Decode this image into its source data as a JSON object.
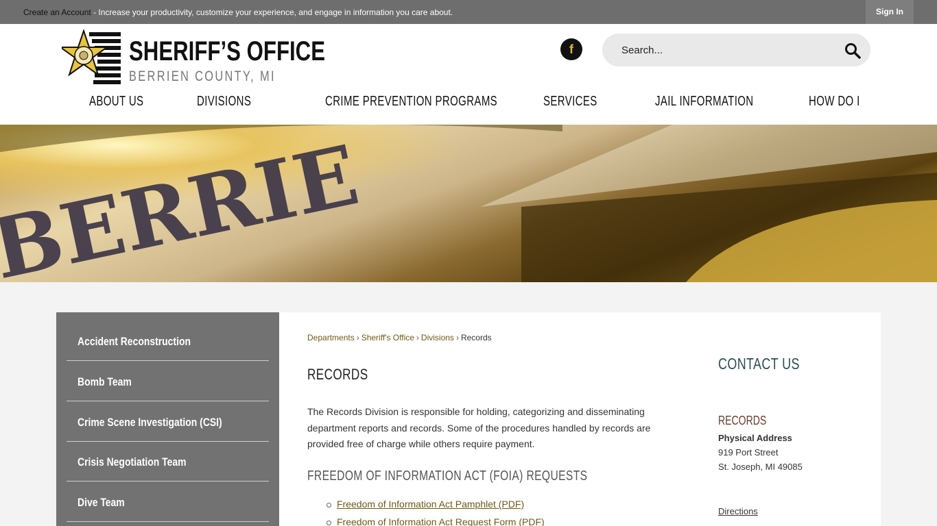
{
  "topbar": {
    "create_link": "Create an Account",
    "message": " - Increase your productivity, customize your experience, and engage in information you care about.",
    "signin": "Sign In"
  },
  "header": {
    "logo_title": "SHERIFF’S OFFICE",
    "logo_subtitle": "BERRIEN COUNTY, MI",
    "facebook_glyph": "f",
    "search_placeholder": "Search..."
  },
  "nav": {
    "items": [
      {
        "label": "ABOUT US"
      },
      {
        "label": "DIVISIONS"
      },
      {
        "label": "CRIME PREVENTION PROGRAMS"
      },
      {
        "label": "SERVICES"
      },
      {
        "label": "JAIL INFORMATION"
      },
      {
        "label": "HOW DO I"
      }
    ]
  },
  "sidebar": {
    "items": [
      {
        "label": "Accident Reconstruction"
      },
      {
        "label": "Bomb Team"
      },
      {
        "label": "Crime Scene Investigation (CSI)"
      },
      {
        "label": "Crisis Negotiation Team"
      },
      {
        "label": "Dive Team"
      }
    ]
  },
  "breadcrumb": {
    "items": [
      "Departments",
      "Sheriff's Office",
      "Divisions"
    ],
    "current": "Records",
    "separator": "›"
  },
  "main": {
    "title": "RECORDS",
    "intro": "The Records Division is responsible for holding, categorizing and disseminating department reports and records. Some of the procedures handled by records are provided free of charge while others require payment.",
    "foia_heading": "FREEDOM OF INFORMATION ACT (FOIA) REQUESTS",
    "foia_links": [
      {
        "label": "Freedom of Information Act Pamphlet (PDF)"
      },
      {
        "label": "Freedom of Information Act Request Form (PDF)"
      }
    ]
  },
  "contact": {
    "title": "CONTACT US",
    "records_heading": "RECORDS",
    "address_label": "Physical Address",
    "address_lines": [
      "919 Port Street",
      "St. Joseph, MI 49085"
    ],
    "directions": "Directions"
  },
  "colors": {
    "topbar": "#6e6e6e",
    "sidebar": "#727272",
    "link": "#6a5a16",
    "contact_title": "#2a4e55",
    "records_heading": "#6b3a2c",
    "facebook_glyph": "#e2b33c"
  },
  "icons": {
    "search": "search-icon",
    "facebook": "facebook-icon",
    "badge": "sheriff-star-badge-icon"
  }
}
